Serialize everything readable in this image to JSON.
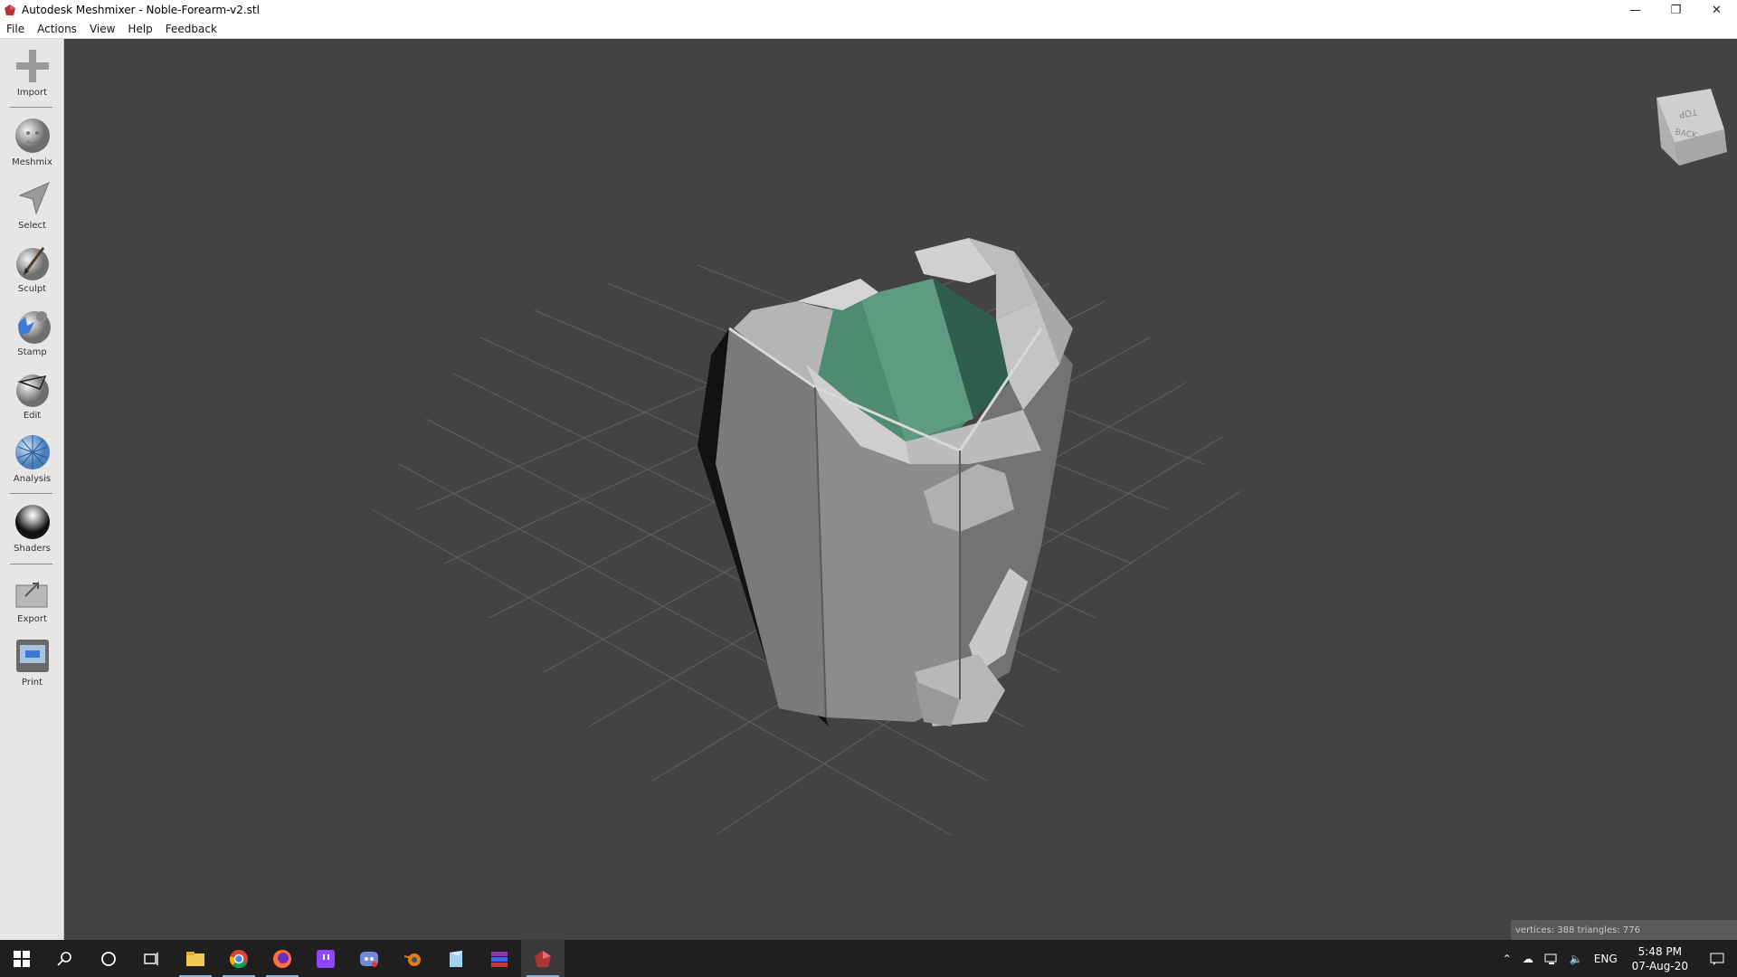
{
  "window": {
    "title": "Autodesk Meshmixer - Noble-Forearm-v2.stl",
    "app_icon": "meshmixer-logo-icon"
  },
  "menu": [
    "File",
    "Actions",
    "View",
    "Help",
    "Feedback"
  ],
  "tools": [
    {
      "label": "Import",
      "icon": "plus-icon"
    },
    {
      "label": "Meshmix",
      "icon": "meshmix-ball-icon"
    },
    {
      "label": "Select",
      "icon": "select-arrow-icon"
    },
    {
      "label": "Sculpt",
      "icon": "sculpt-brush-icon"
    },
    {
      "label": "Stamp",
      "icon": "stamp-icon"
    },
    {
      "label": "Edit",
      "icon": "edit-sphere-icon"
    },
    {
      "label": "Analysis",
      "icon": "analysis-sphere-icon"
    },
    {
      "label": "Shaders",
      "icon": "shaders-ball-icon"
    },
    {
      "label": "Export",
      "icon": "export-icon"
    },
    {
      "label": "Print",
      "icon": "print-icon"
    }
  ],
  "viewcube": {
    "top_label": "TOP",
    "back_label": "BACK"
  },
  "status": {
    "stats": "vertices: 388  triangles: 776"
  },
  "taskbar": {
    "apps": [
      "start-icon",
      "search-icon",
      "cortana-icon",
      "task-view-icon",
      "file-explorer-icon",
      "chrome-icon",
      "firefox-icon",
      "twitch-icon",
      "discord-icon",
      "blender-icon",
      "notes-icon",
      "winrar-icon",
      "meshmixer-icon"
    ],
    "lang": "ENG",
    "time": "5:48 PM",
    "date": "07-Aug-20"
  },
  "colors": {
    "viewport_bg": "#434343",
    "mesh_light": "#c8c8c8",
    "mesh_inner": "#4f8a73",
    "grid": "#6a6a6a"
  }
}
